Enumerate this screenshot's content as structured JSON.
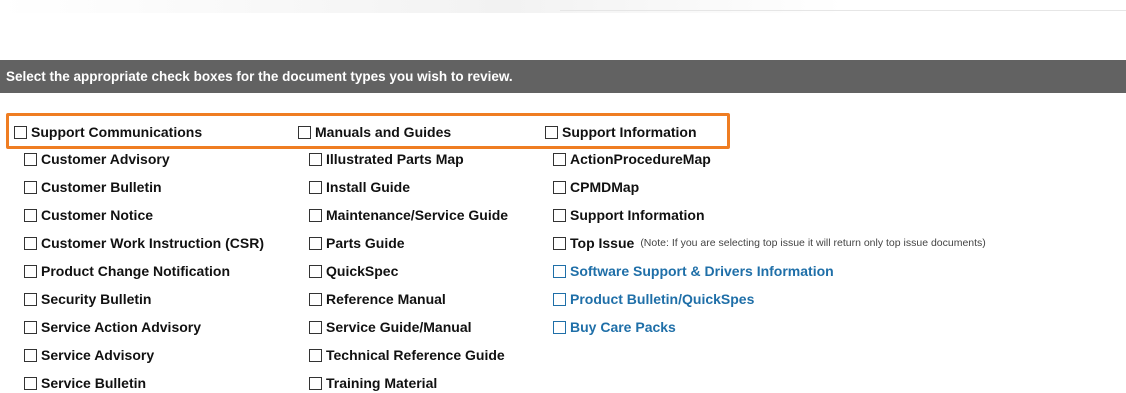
{
  "instruction": "Select the appropriate check boxes for the document types you wish to review.",
  "groups": {
    "support_communications": {
      "label": "Support Communications",
      "items": [
        "Customer Advisory",
        "Customer Bulletin",
        "Customer Notice",
        "Customer Work Instruction (CSR)",
        "Product Change Notification",
        "Security Bulletin",
        "Service Action Advisory",
        "Service Advisory",
        "Service Bulletin"
      ]
    },
    "manuals_and_guides": {
      "label": "Manuals and Guides",
      "items": [
        "Illustrated Parts Map",
        "Install Guide",
        "Maintenance/Service Guide",
        "Parts Guide",
        "QuickSpec",
        "Reference Manual",
        "Service Guide/Manual",
        "Technical Reference Guide",
        "Training Material"
      ]
    },
    "support_information": {
      "label": "Support Information",
      "items": [
        "ActionProcedureMap",
        "CPMDMap",
        "Support Information",
        "Top Issue"
      ],
      "top_issue_note": "(Note: If you are selecting top issue it will return only top issue documents)",
      "links": [
        "Software Support & Drivers Information",
        "Product Bulletin/QuickSpes",
        "Buy Care Packs"
      ]
    }
  },
  "colors": {
    "header_bar": "#626262",
    "highlight": "#ef7d22",
    "link": "#1f6fa8"
  }
}
